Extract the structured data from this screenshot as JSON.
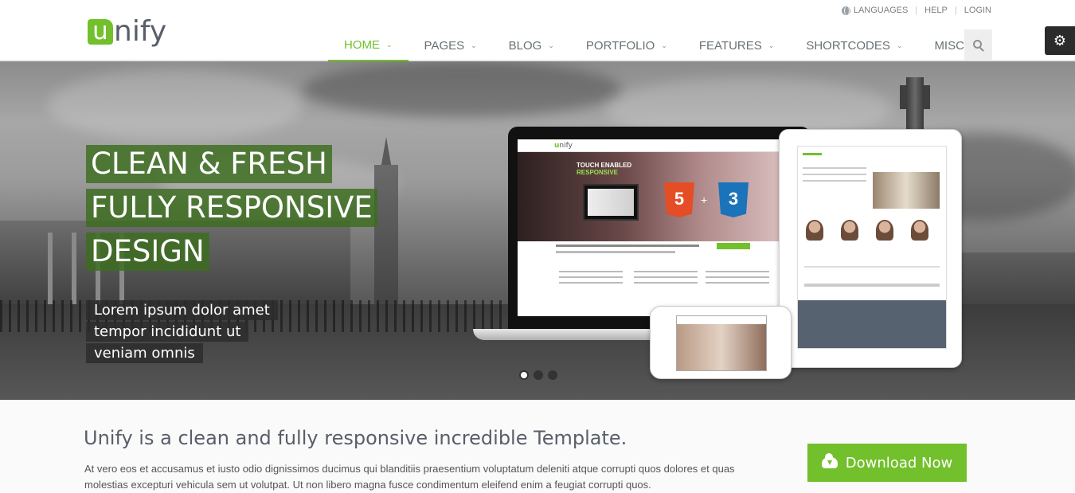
{
  "brand": {
    "logo_letter": "u",
    "logo_rest": "nify"
  },
  "topbar": {
    "languages": "LANGUAGES",
    "help": "HELP",
    "login": "LOGIN",
    "separator": "|"
  },
  "nav": {
    "items": [
      {
        "label": "HOME",
        "active": true
      },
      {
        "label": "PAGES"
      },
      {
        "label": "BLOG"
      },
      {
        "label": "PORTFOLIO"
      },
      {
        "label": "FEATURES"
      },
      {
        "label": "SHORTCODES"
      },
      {
        "label": "MISC"
      }
    ],
    "caret": "⌄"
  },
  "hero": {
    "title_lines": [
      "CLEAN & FRESH",
      "FULLY RESPONSIVE",
      "DESIGN"
    ],
    "subtitle_lines": [
      "Lorem ipsum dolor amet",
      "tempor incididunt ut",
      "veniam omnis"
    ],
    "mockup": {
      "logo": "nify",
      "logo_letter": "u",
      "hero_line1": "TOUCH ENABLED",
      "hero_line2": "RESPONSIVE",
      "html5": "5",
      "css3": "3",
      "plus": "+"
    },
    "slides_count": 3,
    "active_slide": 1
  },
  "purchase": {
    "title": "Unify is a clean and fully responsive incredible Template.",
    "text": "At vero eos et accusamus et iusto odio dignissimos ducimus qui blanditiis praesentium voluptatum deleniti atque corrupti quos dolores et quas molestias excepturi vehicula sem ut volutpat. Ut non libero magna fusce condimentum eleifend enim a feugiat corrupti quos.",
    "button_label": "Download Now"
  },
  "colors": {
    "accent": "#72c02c",
    "text": "#585f69",
    "dark_panel": "#2b2b2b"
  },
  "icons": {
    "globe": "globe-icon",
    "search": "search-icon",
    "gear": "gear-icon",
    "download": "cloud-download-icon"
  }
}
